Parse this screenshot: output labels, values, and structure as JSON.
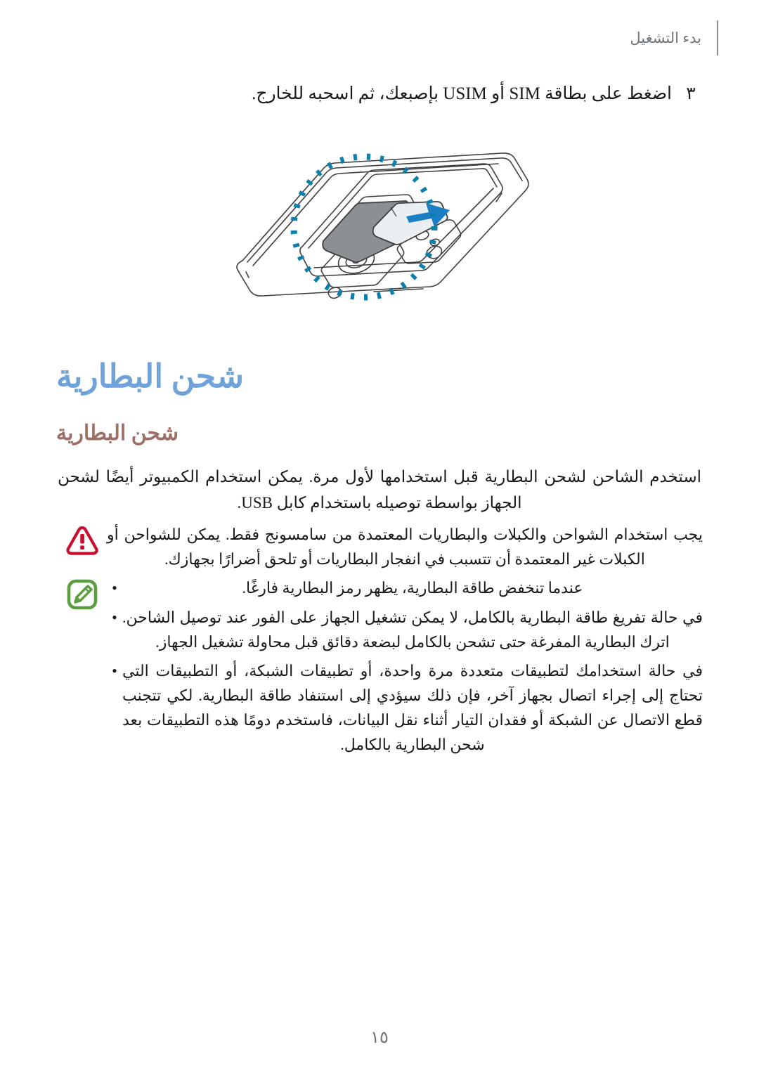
{
  "header": {
    "title": "بدء التشغيل"
  },
  "step": {
    "number": "٣",
    "text": "اضغط على بطاقة SIM أو USIM بإصبعك، ثم اسحبه للخارج."
  },
  "illustration": {
    "name": "phone-back-sim-slot-diagram",
    "highlight_color": "#0b7fab",
    "arrow_color": "#1b7fc4",
    "card_fill": "#8c9094",
    "outline_color": "#3f3f3f"
  },
  "headings": {
    "h1": "شحن البطارية",
    "h1_color": "#6fa2d8",
    "h2": "شحن البطارية",
    "h2_color": "#9e6f66"
  },
  "body": {
    "paragraph": "استخدم الشاحن لشحن البطارية قبل استخدامها لأول مرة. يمكن استخدام الكمبيوتر أيضًا لشحن الجهاز بواسطة توصيله باستخدام كابل USB."
  },
  "warning": {
    "icon": "warning-triangle-icon",
    "icon_color": "#c8102e",
    "text": "يجب استخدام الشواحن والكبلات والبطاريات المعتمدة من سامسونج فقط. يمكن للشواحن أو الكبلات غير المعتمدة أن تتسبب في انفجار البطاريات أو تلحق أضرارًا بجهازك."
  },
  "note": {
    "icon": "note-pencil-icon",
    "icon_color": "#5c9e3f",
    "bullet_char": "•",
    "bullets": [
      "عندما تنخفض طاقة البطارية، يظهر رمز البطارية فارغًا.",
      "في حالة تفريغ طاقة البطارية بالكامل، لا يمكن تشغيل الجهاز على الفور عند توصيل الشاحن. اترك البطارية المفرغة حتى تشحن بالكامل لبضعة دقائق قبل محاولة تشغيل الجهاز.",
      "في حالة استخدامك لتطبيقات متعددة مرة واحدة، أو تطبيقات الشبكة، أو التطبيقات التي تحتاج إلى إجراء اتصال بجهاز آخر، فإن ذلك سيؤدي إلى استنفاد طاقة البطارية. لكي تتجنب قطع الاتصال عن الشبكة أو فقدان التيار أثناء نقل البيانات، فاستخدم دومًا هذه التطبيقات بعد شحن البطارية بالكامل."
    ]
  },
  "footer": {
    "page_number": "١٥"
  }
}
